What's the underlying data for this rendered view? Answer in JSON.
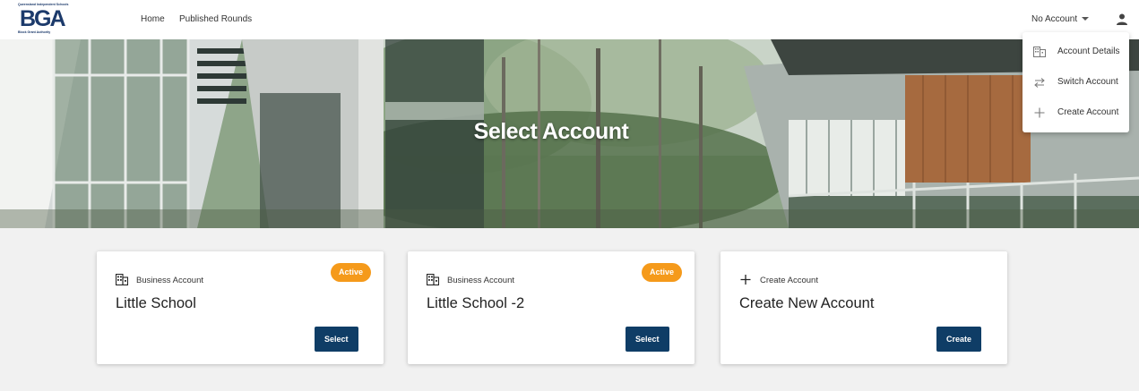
{
  "header": {
    "logo": {
      "top_text": "Queensland Independent Schools",
      "mark": "BGA",
      "bottom_text": "Block Grant Authority"
    },
    "nav": [
      {
        "label": "Home"
      },
      {
        "label": "Published Rounds"
      }
    ],
    "account_switcher": {
      "label": "No Account",
      "icon": "chevron-down-icon"
    },
    "user_icon": "user-icon"
  },
  "hero": {
    "title": "Select Account"
  },
  "account_menu": {
    "items": [
      {
        "label": "Account Details",
        "icon": "building-icon"
      },
      {
        "label": "Switch Account",
        "icon": "swap-icon"
      },
      {
        "label": "Create Account",
        "icon": "plus-icon"
      }
    ]
  },
  "cards": [
    {
      "kind": "Business Account",
      "kind_icon": "building-icon",
      "name": "Little School",
      "badge": "Active",
      "button": "Select"
    },
    {
      "kind": "Business Account",
      "kind_icon": "building-icon",
      "name": "Little School -2",
      "badge": "Active",
      "button": "Select"
    },
    {
      "kind": "Create Account",
      "kind_icon": "plus-icon",
      "name": "Create New Account",
      "button": "Create"
    }
  ],
  "colors": {
    "brand_navy": "#0f3d66",
    "badge_orange": "#f59a1b",
    "content_bg": "#f1f1f1"
  }
}
